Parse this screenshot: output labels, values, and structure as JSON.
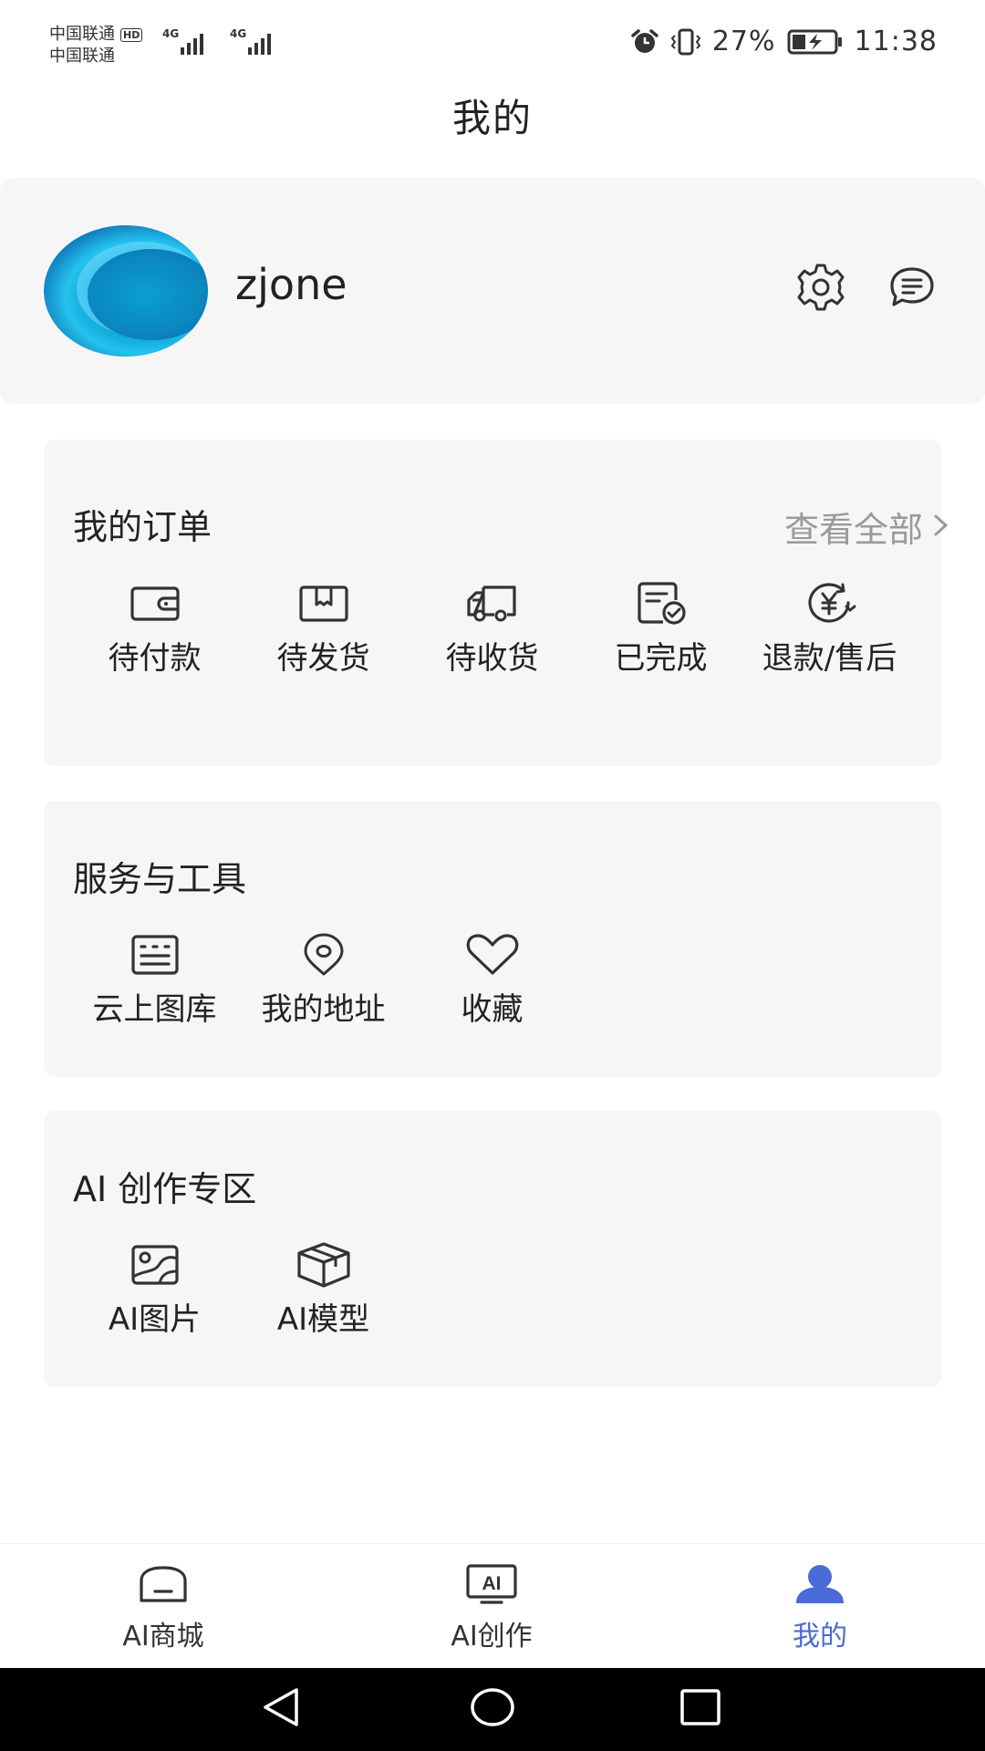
{
  "status_bar": {
    "carrier_1": "中国联通",
    "carrier_2": "中国联通",
    "hd": "HD",
    "network_1": "4G",
    "network_2": "4G",
    "battery": "27%",
    "time": "11:38",
    "icons": [
      "alarm-icon",
      "vibrate-icon",
      "battery-charging-icon"
    ]
  },
  "header": {
    "title": "我的"
  },
  "profile": {
    "username": "zjone",
    "actions": [
      "gear-icon",
      "message-icon"
    ]
  },
  "orders": {
    "title": "我的订单",
    "view_all": "查看全部",
    "items": [
      {
        "label": "待付款",
        "icon": "wallet-icon"
      },
      {
        "label": "待发货",
        "icon": "package-icon"
      },
      {
        "label": "待收货",
        "icon": "truck-icon"
      },
      {
        "label": "已完成",
        "icon": "document-check-icon"
      },
      {
        "label": "退款/售后",
        "icon": "yuan-refund-icon"
      }
    ]
  },
  "services": {
    "title": "服务与工具",
    "items": [
      {
        "label": "云上图库",
        "icon": "gallery-icon"
      },
      {
        "label": "我的地址",
        "icon": "location-icon"
      },
      {
        "label": "收藏",
        "icon": "heart-icon"
      }
    ]
  },
  "ai_zone": {
    "title": "AI 创作专区",
    "items": [
      {
        "label": "AI图片",
        "icon": "image-icon"
      },
      {
        "label": "AI模型",
        "icon": "cube-icon"
      }
    ]
  },
  "bottom_nav": {
    "active": "我的",
    "items": [
      {
        "label": "AI商城",
        "icon": "home-icon"
      },
      {
        "label": "AI创作",
        "icon": "ai-screen-icon"
      },
      {
        "label": "我的",
        "icon": "user-icon"
      }
    ]
  },
  "colors": {
    "accent": "#4a6bd6",
    "card_bg": "#f6f6f6",
    "muted_text": "#9a9a9a"
  }
}
